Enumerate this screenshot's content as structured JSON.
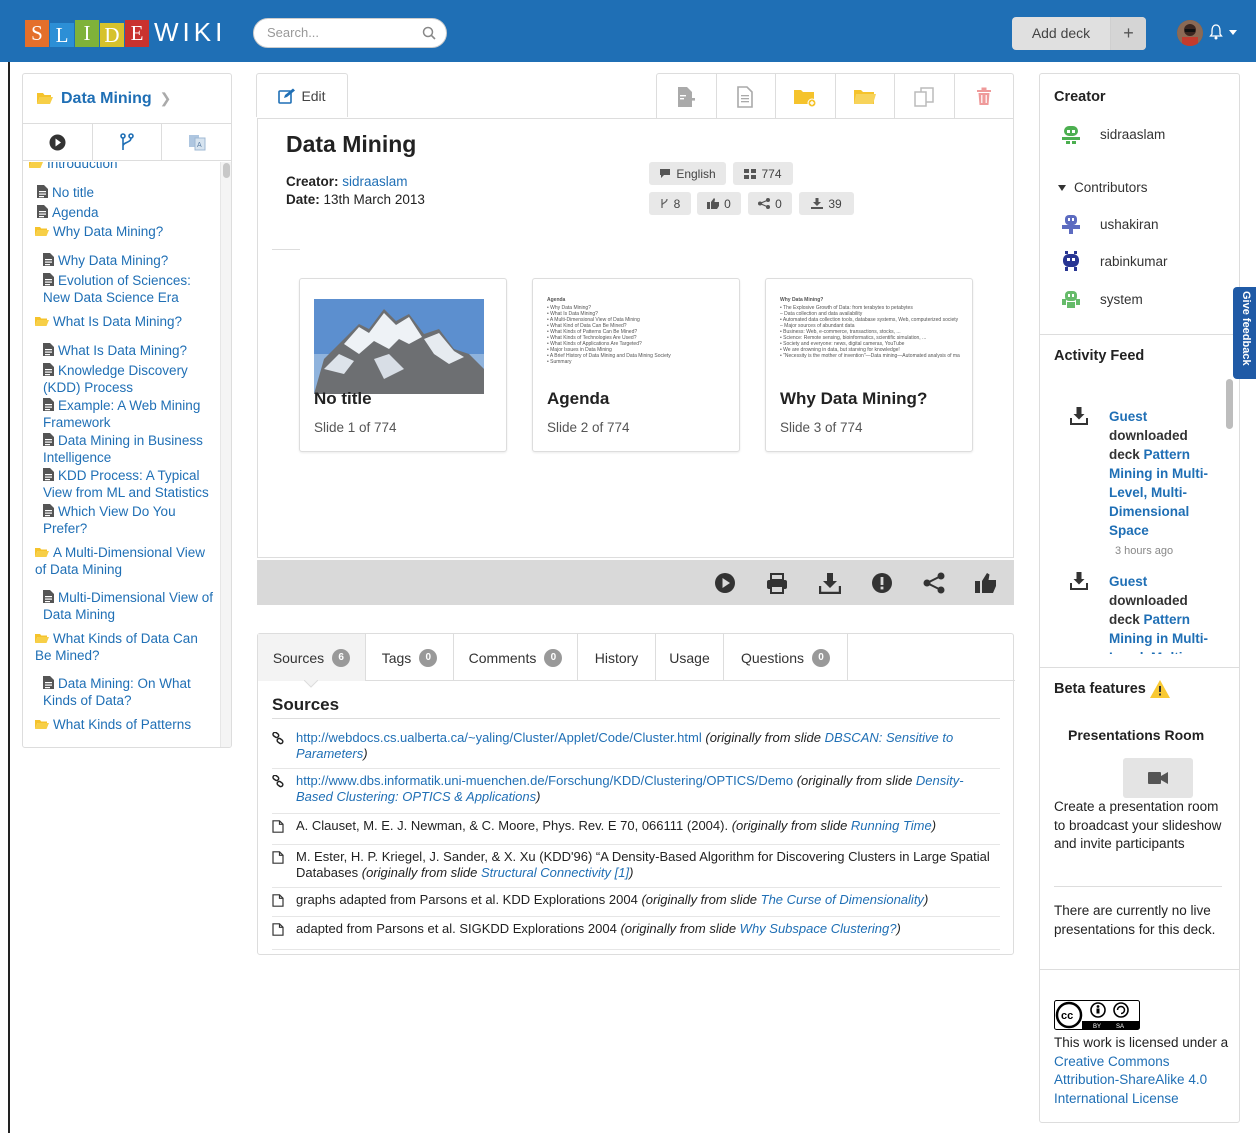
{
  "header": {
    "logo_letters": [
      "S",
      "L",
      "I",
      "D",
      "E"
    ],
    "logo_wiki": "WIKI",
    "search_placeholder": "Search...",
    "add_deck_label": "Add deck",
    "add_deck_plus": "+",
    "brand_color": "#1f6fb5"
  },
  "left_nav": {
    "deck_title": "Data Mining",
    "tabs": [
      "play-icon",
      "fork-icon",
      "translate-icon"
    ],
    "tree": [
      {
        "type": "folder",
        "label": "Introduction"
      },
      {
        "type": "slide",
        "label": "No title"
      },
      {
        "type": "slide",
        "label": "Agenda"
      },
      {
        "type": "folder",
        "label": "Why Data Mining?"
      },
      {
        "type": "slide",
        "label": "Why Data Mining?"
      },
      {
        "type": "slide",
        "label": "Evolution of Sciences: New Data Science Era"
      },
      {
        "type": "folder",
        "label": "What Is Data Mining?"
      },
      {
        "type": "slide",
        "label": "What Is Data Mining?"
      },
      {
        "type": "slide",
        "label": "Knowledge Discovery (KDD) Process"
      },
      {
        "type": "slide",
        "label": "Example: A Web Mining Framework"
      },
      {
        "type": "slide",
        "label": "Data Mining in Business Intelligence"
      },
      {
        "type": "slide",
        "label": "KDD Process: A Typical View from ML and Statistics"
      },
      {
        "type": "slide",
        "label": "Which View Do You Prefer?"
      },
      {
        "type": "folder",
        "label": "A Multi-Dimensional View of Data Mining"
      },
      {
        "type": "slide",
        "label": "Multi-Dimensional View of Data Mining"
      },
      {
        "type": "folder",
        "label": "What Kinds of Data Can Be Mined?"
      },
      {
        "type": "slide",
        "label": "Data Mining: On What Kinds of Data?"
      },
      {
        "type": "folder",
        "label": "What Kinds of Patterns"
      }
    ]
  },
  "deck": {
    "edit_label": "Edit",
    "title": "Data Mining",
    "creator_label": "Creator:",
    "creator_name": "sidraaslam",
    "date_label": "Date:",
    "date_value": "13th March 2013",
    "language": "English",
    "slide_count": "774",
    "forks": "8",
    "likes": "0",
    "shares": "0",
    "downloads": "39",
    "slides": [
      {
        "title": "No title",
        "sub": "Slide 1 of 774"
      },
      {
        "title": "Agenda",
        "sub": "Slide 2 of 774"
      },
      {
        "title": "Why Data Mining?",
        "sub": "Slide 3 of 774"
      }
    ],
    "thumb_agenda_lines": [
      "Agenda",
      "• Why Data Mining?",
      "• What Is Data Mining?",
      "• A Multi-Dimensional View of Data Mining",
      "• What Kind of Data Can Be Mined?",
      "• What Kinds of Patterns Can Be Mined?",
      "• What Kinds of Technologies Are Used?",
      "• What Kinds of Applications Are Targeted?",
      "• Major Issues in Data Mining",
      "• A Brief History of Data Mining and Data Mining Society",
      "• Summary"
    ],
    "thumb_why_lines": [
      "Why Data Mining?",
      "• The Explosive Growth of Data: from terabytes to petabytes",
      "  – Data collection and data availability",
      "    • Automated data collection tools, database systems, Web, computerized society",
      "  – Major sources of abundant data",
      "    • Business: Web, e-commerce, transactions, stocks, ...",
      "    • Science: Remote sensing, bioinformatics, scientific simulation, ...",
      "    • Society and everyone: news, digital cameras, YouTube",
      "• We are drowning in data, but starving for knowledge!",
      "• \"Necessity is the mother of invention\"—Data mining—Automated analysis of massive data sets"
    ]
  },
  "tabs": [
    {
      "label": "Sources",
      "badge": "6"
    },
    {
      "label": "Tags",
      "badge": "0"
    },
    {
      "label": "Comments",
      "badge": "0"
    },
    {
      "label": "History",
      "badge": ""
    },
    {
      "label": "Usage",
      "badge": ""
    },
    {
      "label": "Questions",
      "badge": "0"
    }
  ],
  "sources": {
    "heading": "Sources",
    "orig_prefix": "(originally from slide ",
    "orig_suffix": ")",
    "items": [
      {
        "kind": "link",
        "text": "http://webdocs.cs.ualberta.ca/~yaling/Cluster/Applet/Code/Cluster.html",
        "slide": "DBSCAN: Sensitive to Parameters"
      },
      {
        "kind": "link",
        "text": "http://www.dbs.informatik.uni-muenchen.de/Forschung/KDD/Clustering/OPTICS/Demo",
        "slide": "Density-Based Clustering: OPTICS & Applications"
      },
      {
        "kind": "doc",
        "text": "A. Clauset, M. E. J. Newman, & C. Moore, Phys. Rev. E 70, 066111 (2004).",
        "slide": "Running Time"
      },
      {
        "kind": "doc",
        "text": "M. Ester, H. P. Kriegel, J. Sander, & X. Xu (KDD'96) “A Density-Based Algorithm for Discovering Clusters in Large Spatial Databases",
        "slide": "Structural Connectivity [1]"
      },
      {
        "kind": "doc",
        "text": "graphs adapted from Parsons et al. KDD Explorations 2004",
        "slide": "The Curse of Dimensionality"
      },
      {
        "kind": "doc",
        "text": "adapted from Parsons et al. SIGKDD Explorations 2004",
        "slide": "Why Subspace Clustering?"
      }
    ]
  },
  "right_panel": {
    "creator_heading": "Creator",
    "creator": "sidraaslam",
    "contributors_heading": "Contributors",
    "contributors": [
      "ushakiran",
      "rabinkumar",
      "system"
    ],
    "activity_heading": "Activity Feed",
    "feed": [
      {
        "who": "Guest",
        "action": "downloaded deck",
        "deck": "Pattern Mining in Multi-Level, Multi-Dimensional Space",
        "ago": "3 hours ago"
      },
      {
        "who": "Guest",
        "action": "downloaded deck",
        "deck": "Pattern Mining in Multi-Level, Multi-",
        "ago": ""
      }
    ],
    "beta_heading": "Beta features",
    "presentations_heading": "Presentations Room",
    "presentations_text": "Create a presentation room to broadcast your slideshow and invite participants",
    "no_live_text": "There are currently no live presentations for this deck.",
    "license_prefix": "This work is licensed under a ",
    "license_link": "Creative Commons Attribution-ShareAlike 4.0 International License",
    "cc_badge_lines": [
      "BY",
      "SA"
    ]
  },
  "feedback_tab": "Give feedback"
}
